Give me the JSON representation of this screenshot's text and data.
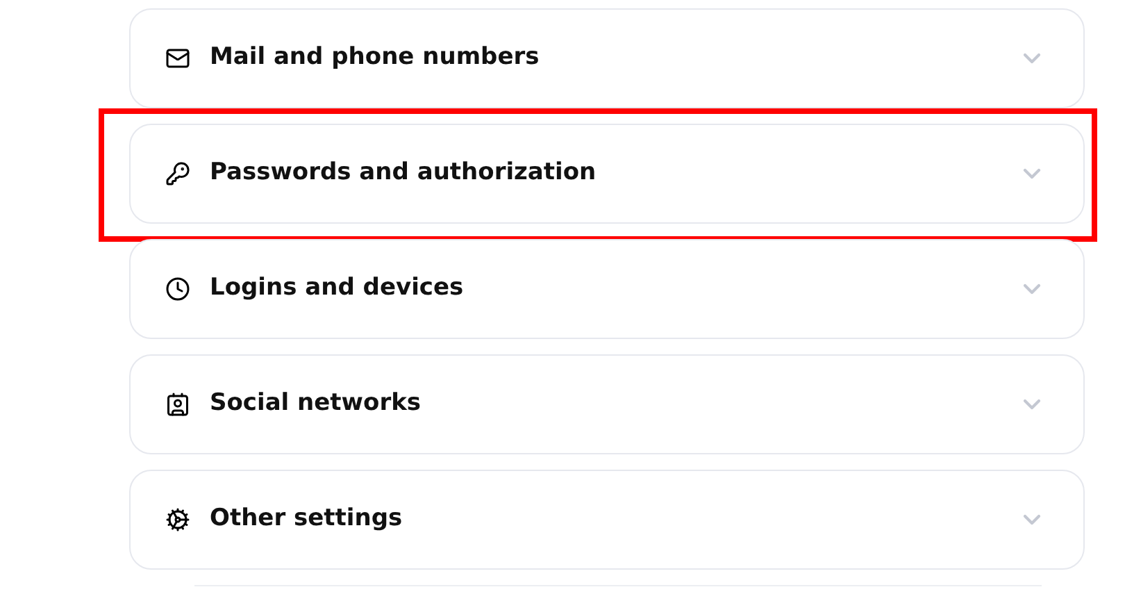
{
  "sections": [
    {
      "kind": "mail",
      "label": "Mail and phone numbers",
      "expanded": false,
      "highlighted": false
    },
    {
      "kind": "key",
      "label": "Passwords and authorization",
      "expanded": false,
      "highlighted": true
    },
    {
      "kind": "clock",
      "label": "Logins and devices",
      "expanded": false,
      "highlighted": false
    },
    {
      "kind": "badge",
      "label": "Social networks",
      "expanded": false,
      "highlighted": false
    },
    {
      "kind": "gear",
      "label": "Other settings",
      "expanded": false,
      "highlighted": false
    }
  ]
}
